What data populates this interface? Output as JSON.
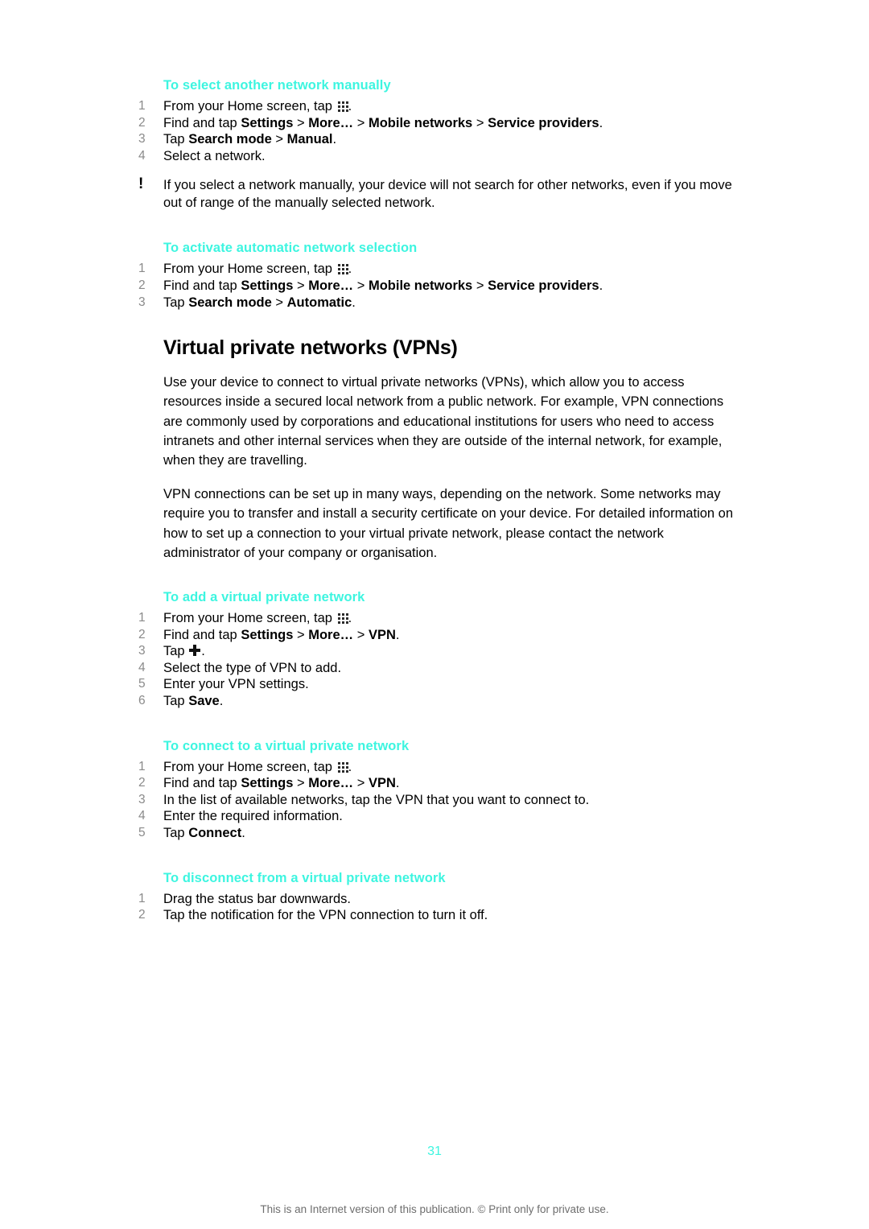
{
  "document": {
    "page_number": "31",
    "footer_note": "This is an Internet version of this publication. © Print only for private use.",
    "accent_color": "#3DF5E0"
  },
  "sections": [
    {
      "id": "select-another-network-manually",
      "heading": "To select another network manually",
      "steps": [
        {
          "num": "1",
          "prefix": "From your Home screen, tap ",
          "icon": "app-drawer-icon",
          "suffix": "."
        },
        {
          "num": "2",
          "prefix": "Find and tap ",
          "bold1": "Settings",
          "sep1": " > ",
          "bold2": "More…",
          "sep2": " > ",
          "bold3": "Mobile networks",
          "sep3": " > ",
          "bold4": "Service providers",
          "suffix": "."
        },
        {
          "num": "3",
          "prefix": "Tap ",
          "bold1": "Search mode",
          "sep1": " > ",
          "bold2": "Manual",
          "suffix": "."
        },
        {
          "num": "4",
          "prefix": "Select a network."
        }
      ],
      "note": {
        "mark": "!",
        "text": "If you select a network manually, your device will not search for other networks, even if you move out of range of the manually selected network."
      }
    },
    {
      "id": "activate-automatic-network-selection",
      "heading": "To activate automatic network selection",
      "steps": [
        {
          "num": "1",
          "prefix": "From your Home screen, tap ",
          "icon": "app-drawer-icon",
          "suffix": "."
        },
        {
          "num": "2",
          "prefix": "Find and tap ",
          "bold1": "Settings",
          "sep1": " > ",
          "bold2": "More…",
          "sep2": " > ",
          "bold3": "Mobile networks",
          "sep3": " > ",
          "bold4": "Service providers",
          "suffix": "."
        },
        {
          "num": "3",
          "prefix": "Tap ",
          "bold1": "Search mode",
          "sep1": " > ",
          "bold2": "Automatic",
          "suffix": "."
        }
      ]
    }
  ],
  "main": {
    "title": "Virtual private networks (VPNs)",
    "paragraphs": [
      "Use your device to connect to virtual private networks (VPNs), which allow you to access resources inside a secured local network from a public network. For example, VPN connections are commonly used by corporations and educational institutions for users who need to access intranets and other internal services when they are outside of the internal network, for example, when they are travelling.",
      "VPN connections can be set up in many ways, depending on the network. Some networks may require you to transfer and install a security certificate on your device. For detailed information on how to set up a connection to your virtual private network, please contact the network administrator of your company or organisation."
    ]
  },
  "vpn_sections": [
    {
      "id": "add-a-virtual-private-network",
      "heading": "To add a virtual private network",
      "steps": [
        {
          "num": "1",
          "prefix": "From your Home screen, tap ",
          "icon": "app-drawer-icon",
          "suffix": "."
        },
        {
          "num": "2",
          "prefix": "Find and tap ",
          "bold1": "Settings",
          "sep1": " > ",
          "bold2": "More…",
          "sep2": " > ",
          "bold3": "VPN",
          "suffix": "."
        },
        {
          "num": "3",
          "prefix": "Tap ",
          "icon": "plus-icon",
          "suffix": "."
        },
        {
          "num": "4",
          "prefix": "Select the type of VPN to add."
        },
        {
          "num": "5",
          "prefix": "Enter your VPN settings."
        },
        {
          "num": "6",
          "prefix": "Tap ",
          "bold1": "Save",
          "suffix": "."
        }
      ]
    },
    {
      "id": "connect-to-a-virtual-private-network",
      "heading": "To connect to a virtual private network",
      "steps": [
        {
          "num": "1",
          "prefix": "From your Home screen, tap ",
          "icon": "app-drawer-icon",
          "suffix": "."
        },
        {
          "num": "2",
          "prefix": "Find and tap ",
          "bold1": "Settings",
          "sep1": " > ",
          "bold2": "More…",
          "sep2": " > ",
          "bold3": "VPN",
          "suffix": "."
        },
        {
          "num": "3",
          "prefix": "In the list of available networks, tap the VPN that you want to connect to."
        },
        {
          "num": "4",
          "prefix": "Enter the required information."
        },
        {
          "num": "5",
          "prefix": "Tap ",
          "bold1": "Connect",
          "suffix": "."
        }
      ]
    },
    {
      "id": "disconnect-from-a-virtual-private-network",
      "heading": "To disconnect from a virtual private network",
      "steps": [
        {
          "num": "1",
          "prefix": "Drag the status bar downwards."
        },
        {
          "num": "2",
          "prefix": "Tap the notification for the VPN connection to turn it off."
        }
      ]
    }
  ]
}
